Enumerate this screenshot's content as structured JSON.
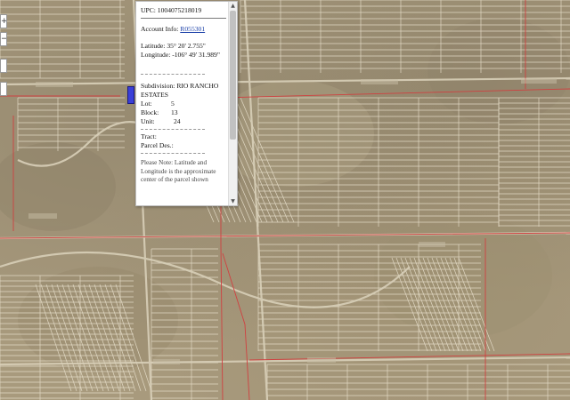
{
  "popup": {
    "upc_label": "UPC:",
    "upc_value": "1004075218019",
    "account_label": "Account Info:",
    "account_value": "R055301",
    "latitude_label": "Latitude:",
    "latitude_value": "35° 20' 2.755\"",
    "longitude_label": "Longitude:",
    "longitude_value": "-106° 49' 31.989\"",
    "subdivision_label": "Subdivision:",
    "subdivision_value": "RIO RANCHO",
    "subdivision_value_cont": "ESTATES",
    "lot_label": "Lot:",
    "lot_value": "5",
    "block_label": "Block:",
    "block_value": "13",
    "unit_label": "Unit:",
    "unit_value": "24",
    "tract_label": "Tract:",
    "parcel_des_label": "Parcel Des.:",
    "note_line1": "Please Note: Latitude and Longitude is",
    "note_line2": "the approximate center of the parcel",
    "note_line3": "shown"
  },
  "scrollbar": {
    "up_icon": "▲",
    "down_icon": "▼"
  },
  "zoom_controls": {
    "zoom_in": "+",
    "zoom_out": "−"
  },
  "colors": {
    "parcel_line": "#e8e0cc",
    "boundary_line": "#d04040",
    "marker": "#3a3fd8",
    "link": "#1a3fa8"
  }
}
